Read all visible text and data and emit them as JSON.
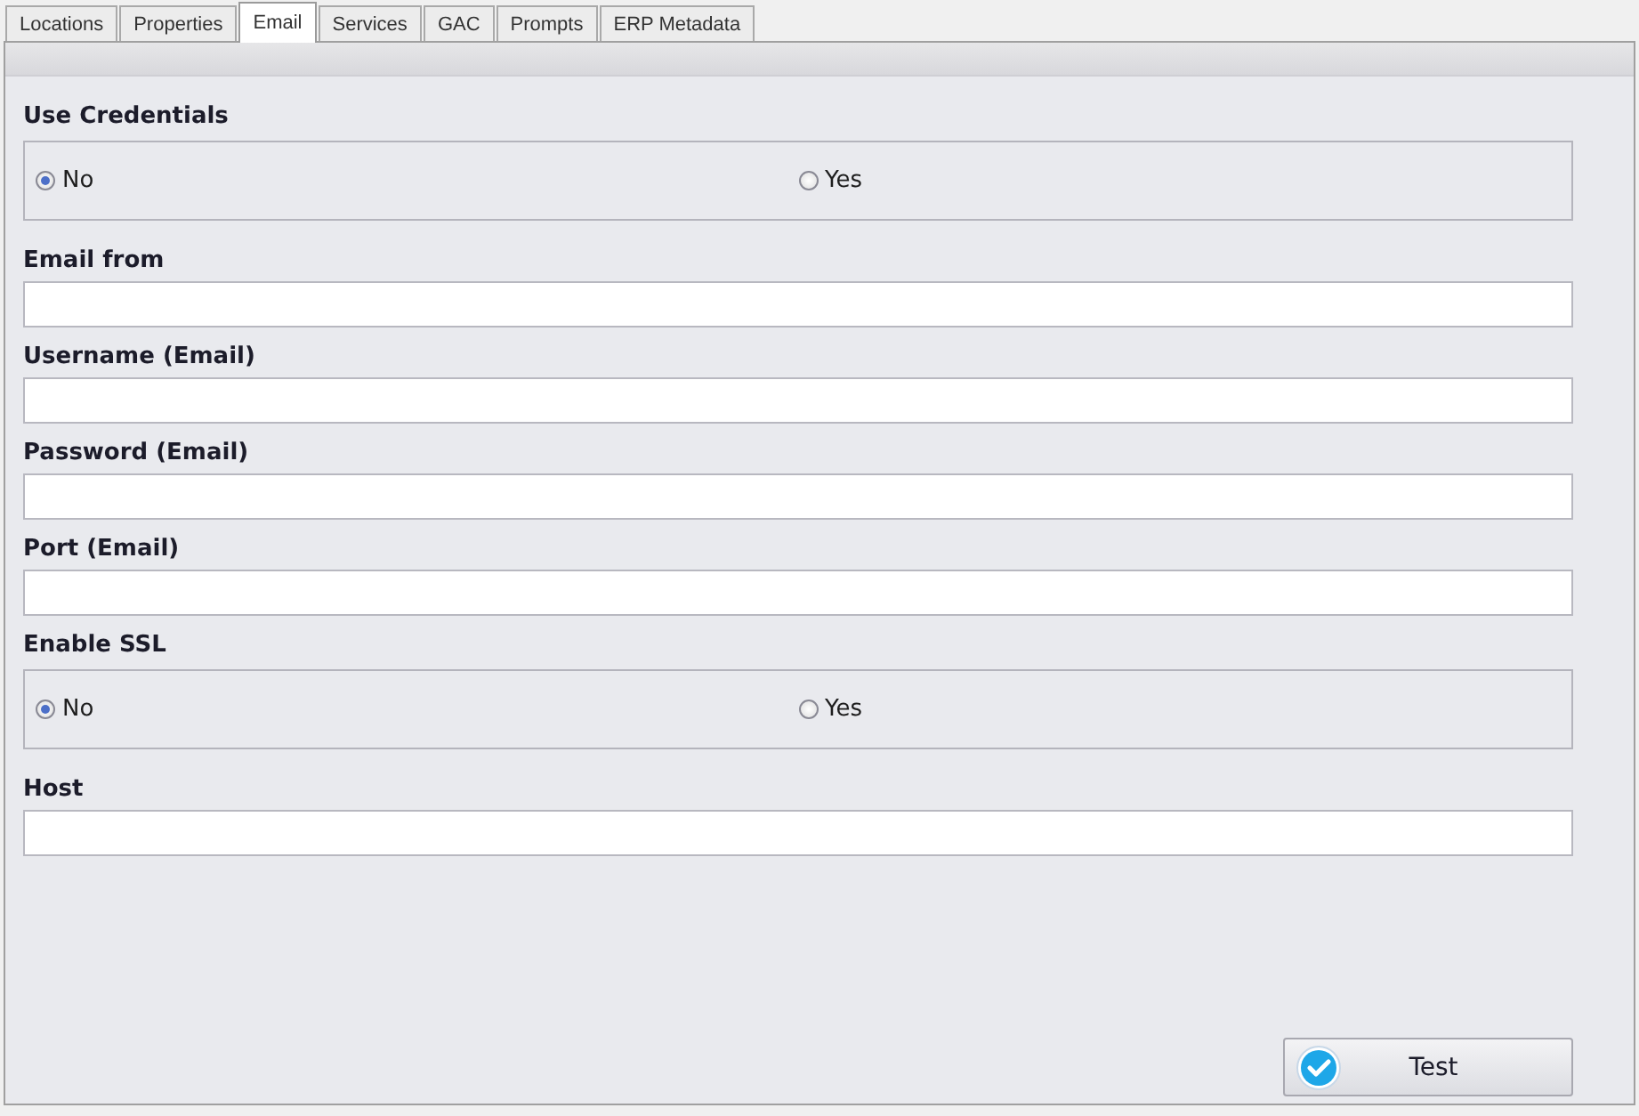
{
  "tabs": [
    {
      "label": "Locations",
      "selected": false
    },
    {
      "label": "Properties",
      "selected": false
    },
    {
      "label": "Email",
      "selected": true
    },
    {
      "label": "Services",
      "selected": false
    },
    {
      "label": "GAC",
      "selected": false
    },
    {
      "label": "Prompts",
      "selected": false
    },
    {
      "label": "ERP Metadata",
      "selected": false
    }
  ],
  "fields": [
    {
      "kind": "radio",
      "label": "Use Credentials",
      "options": [
        {
          "label": "No",
          "selected": true
        },
        {
          "label": "Yes",
          "selected": false
        }
      ]
    },
    {
      "kind": "text",
      "label": "Email from"
    },
    {
      "kind": "text",
      "label": "Username (Email)"
    },
    {
      "kind": "text",
      "label": "Password (Email)"
    },
    {
      "kind": "text",
      "label": "Port (Email)"
    },
    {
      "kind": "radio",
      "label": "Enable SSL",
      "options": [
        {
          "label": "No",
          "selected": true
        },
        {
          "label": "Yes",
          "selected": false
        }
      ]
    },
    {
      "kind": "text",
      "label": "Host"
    }
  ],
  "test_button": {
    "label": "Test"
  }
}
